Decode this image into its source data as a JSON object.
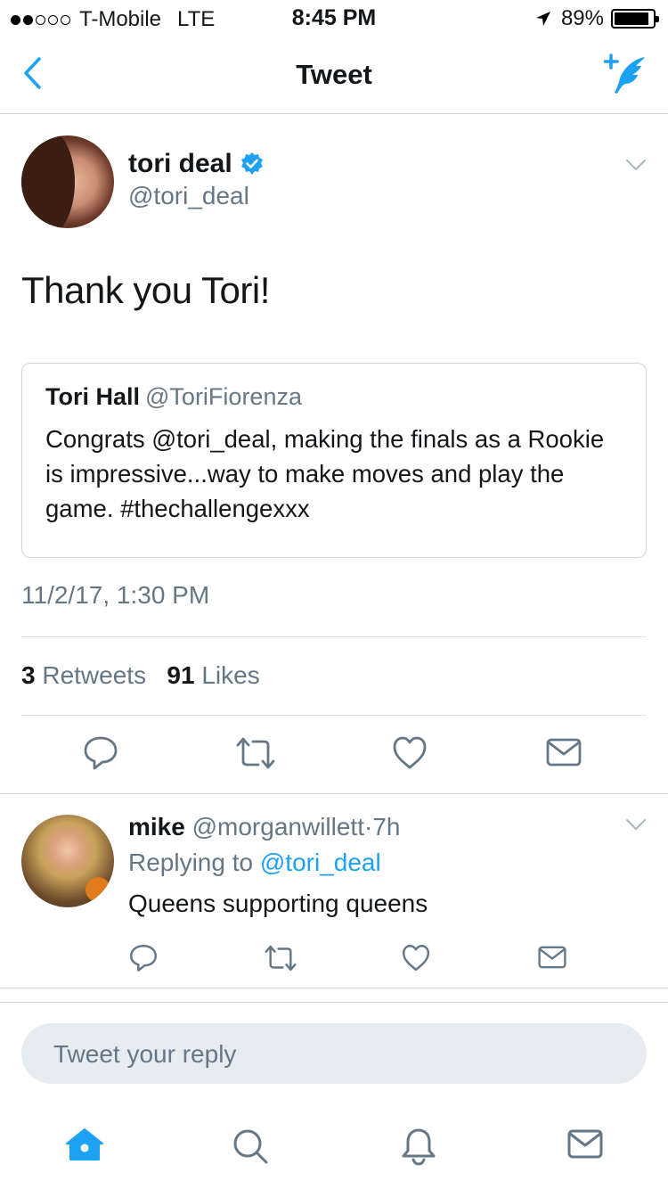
{
  "status_bar": {
    "carrier": "T-Mobile",
    "network": "LTE",
    "time": "8:45 PM",
    "battery": "89%"
  },
  "nav": {
    "title": "Tweet",
    "back_icon": "chevron-left-icon",
    "compose_icon": "compose-tweet-icon"
  },
  "tweet": {
    "author_name": "tori deal",
    "author_handle": "@tori_deal",
    "text": "Thank you Tori!",
    "timestamp": "11/2/17, 1:30 PM",
    "retweets_count": "3",
    "retweets_label": "Retweets",
    "likes_count": "91",
    "likes_label": "Likes"
  },
  "quoted": {
    "name": "Tori Hall",
    "handle": "@ToriFiorenza",
    "text": "Congrats @tori_deal, making the finals as a Rookie is impressive...way to make moves and play the game. #thechallengexxx"
  },
  "reply": {
    "name": "mike",
    "handle": "@morganwillett",
    "sep": "·",
    "time": "7h",
    "replying_prefix": "Replying to",
    "replying_to": "@tori_deal",
    "text": "Queens supporting queens"
  },
  "composer": {
    "placeholder": "Tweet your reply"
  },
  "colors": {
    "accent": "#1da1f2",
    "secondary_text": "#657786",
    "divider": "#cfd6dc"
  }
}
